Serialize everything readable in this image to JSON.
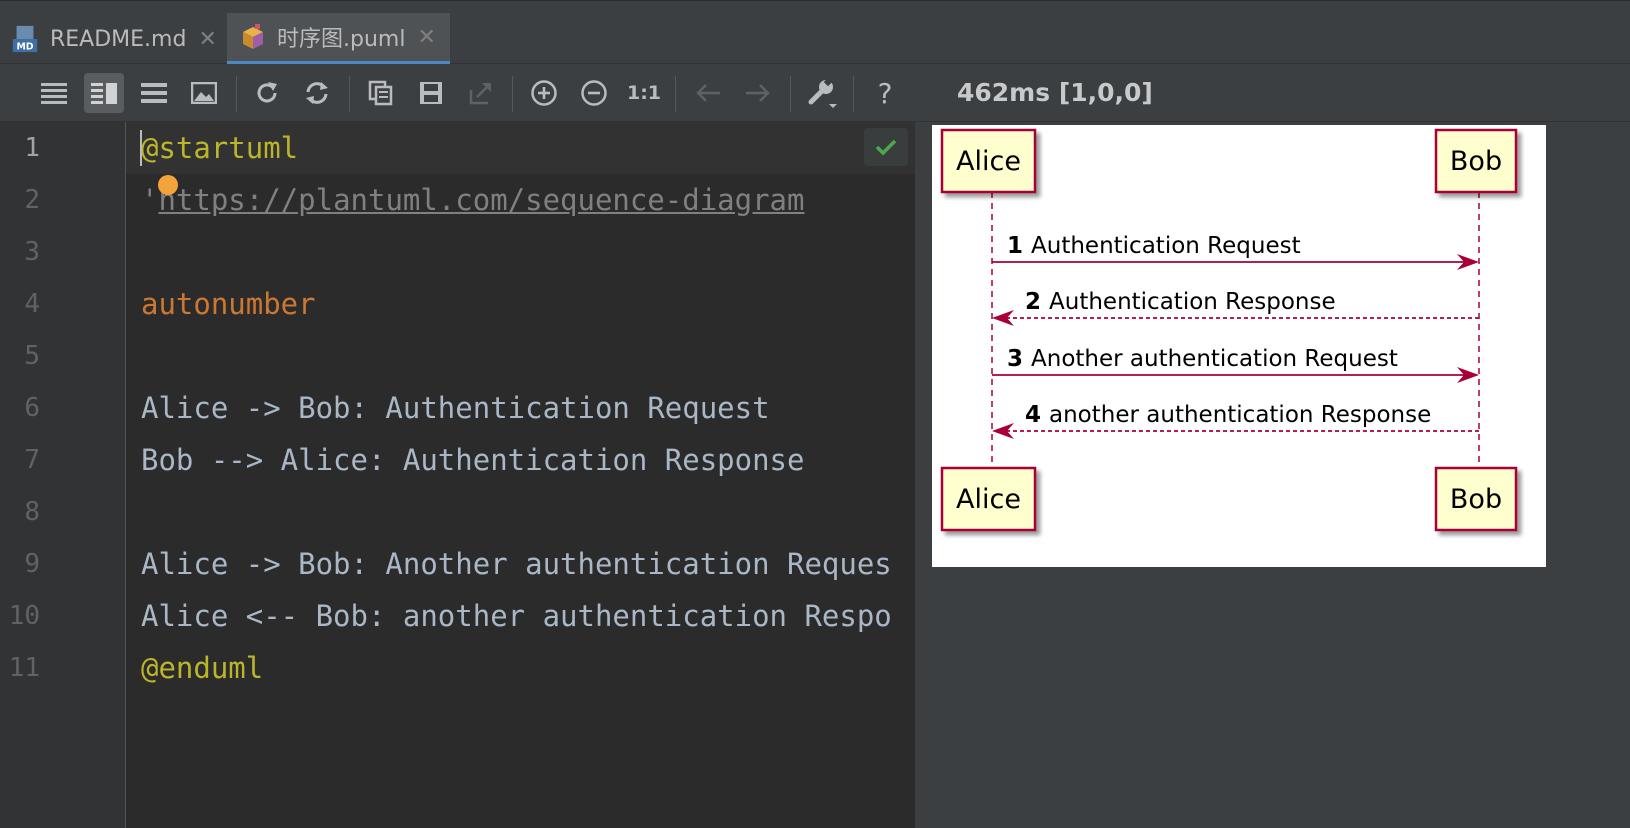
{
  "tabs": [
    {
      "label": "README.md",
      "icon": "markdown-file-icon",
      "icon_text": "MD"
    },
    {
      "label": "时序图.puml",
      "icon": "plantuml-file-icon"
    }
  ],
  "toolbar": {
    "timing": "462ms [1,0,0]",
    "zoom_reset_label": "1:1",
    "help_label": "?"
  },
  "editor": {
    "line_numbers": [
      "1",
      "2",
      "3",
      "4",
      "5",
      "6",
      "7",
      "8",
      "9",
      "10",
      "11"
    ],
    "lines": [
      {
        "text": "@startuml",
        "style": "directive"
      },
      {
        "text": "'",
        "style": "comment"
      },
      {
        "text": "",
        "style": "plain"
      },
      {
        "text": "autonumber",
        "style": "keyword"
      },
      {
        "text": "",
        "style": "plain"
      },
      {
        "text": "Alice -> Bob: Authentication Request",
        "style": "plain"
      },
      {
        "text": "Bob --> Alice: Authentication Response",
        "style": "plain"
      },
      {
        "text": "",
        "style": "plain"
      },
      {
        "text": "Alice -> Bob: Another authentication Reques",
        "style": "plain"
      },
      {
        "text": "Alice <-- Bob: another authentication Respo",
        "style": "plain"
      },
      {
        "text": "@enduml",
        "style": "directive"
      }
    ],
    "url": "https://plantuml.com/sequence-diagram"
  },
  "diagram": {
    "participants": [
      "Alice",
      "Bob"
    ],
    "messages": [
      {
        "num": "1",
        "text": "Authentication Request",
        "from": "Alice",
        "to": "Bob",
        "dashed": false
      },
      {
        "num": "2",
        "text": "Authentication Response",
        "from": "Bob",
        "to": "Alice",
        "dashed": true
      },
      {
        "num": "3",
        "text": "Another authentication Request",
        "from": "Alice",
        "to": "Bob",
        "dashed": false
      },
      {
        "num": "4",
        "text": "another authentication Response",
        "from": "Bob",
        "to": "Alice",
        "dashed": true
      }
    ],
    "colors": {
      "participant_fill": "#fefece",
      "participant_border": "#a80036",
      "arrow": "#a80036"
    }
  },
  "colors": {
    "accent_tab": "#4a88c7",
    "check": "#4ca84c",
    "bulb": "#f2a33a"
  }
}
